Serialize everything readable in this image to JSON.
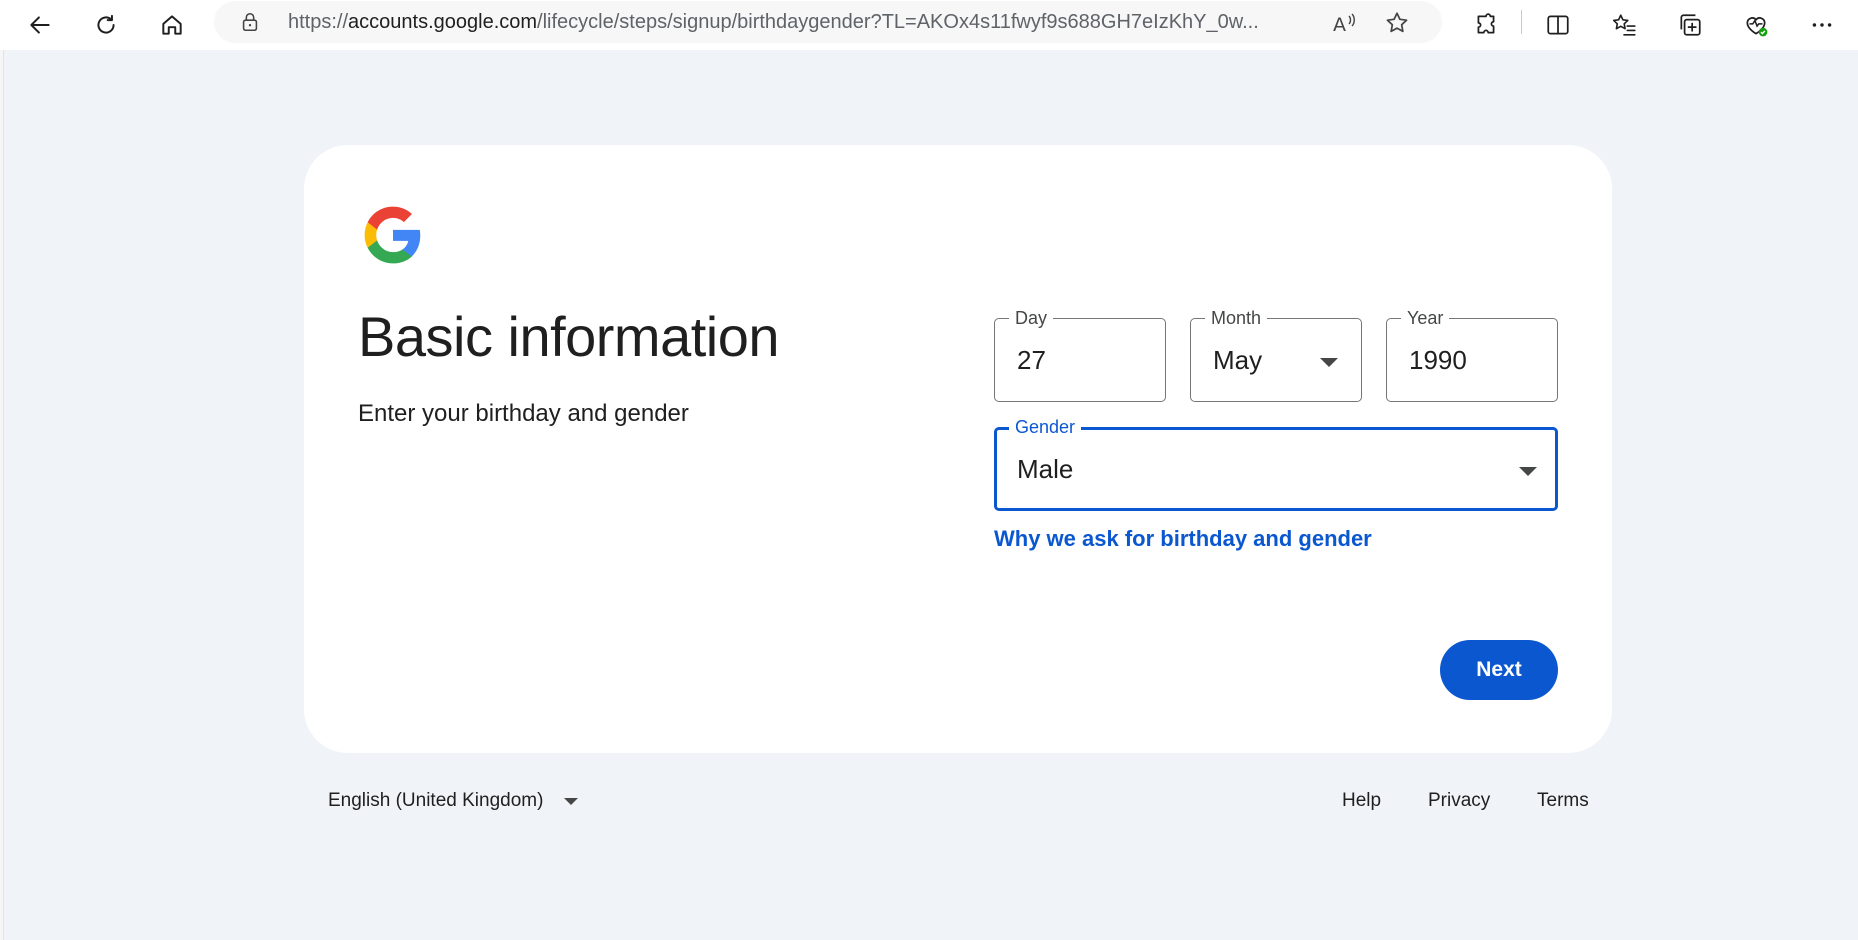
{
  "browser": {
    "url_prefix": "https://",
    "url_host": "accounts.google.com",
    "url_rest": "/lifecycle/steps/signup/birthdaygender?TL=AKOx4s11fwyf9s688GH7eIzKhY_0w...",
    "icons": [
      "back-icon",
      "refresh-icon",
      "home-icon",
      "lock-icon",
      "read-aloud-icon",
      "favorite-star-icon",
      "extensions-icon",
      "split-screen-icon",
      "favorites-icon",
      "collections-icon",
      "browser-essentials-icon",
      "more-icon"
    ]
  },
  "page": {
    "title": "Basic information",
    "subtitle": "Enter your birthday and gender"
  },
  "form": {
    "day": {
      "label": "Day",
      "value": "27"
    },
    "month": {
      "label": "Month",
      "value": "May"
    },
    "year": {
      "label": "Year",
      "value": "1990"
    },
    "gender": {
      "label": "Gender",
      "value": "Male"
    },
    "why_link": "Why we ask for birthday and gender",
    "next_label": "Next"
  },
  "footer": {
    "language": "English (United Kingdom)",
    "help": "Help",
    "privacy": "Privacy",
    "terms": "Terms"
  },
  "colors": {
    "background": "#f0f4f9",
    "accent": "#0b57d0",
    "card": "#ffffff"
  }
}
